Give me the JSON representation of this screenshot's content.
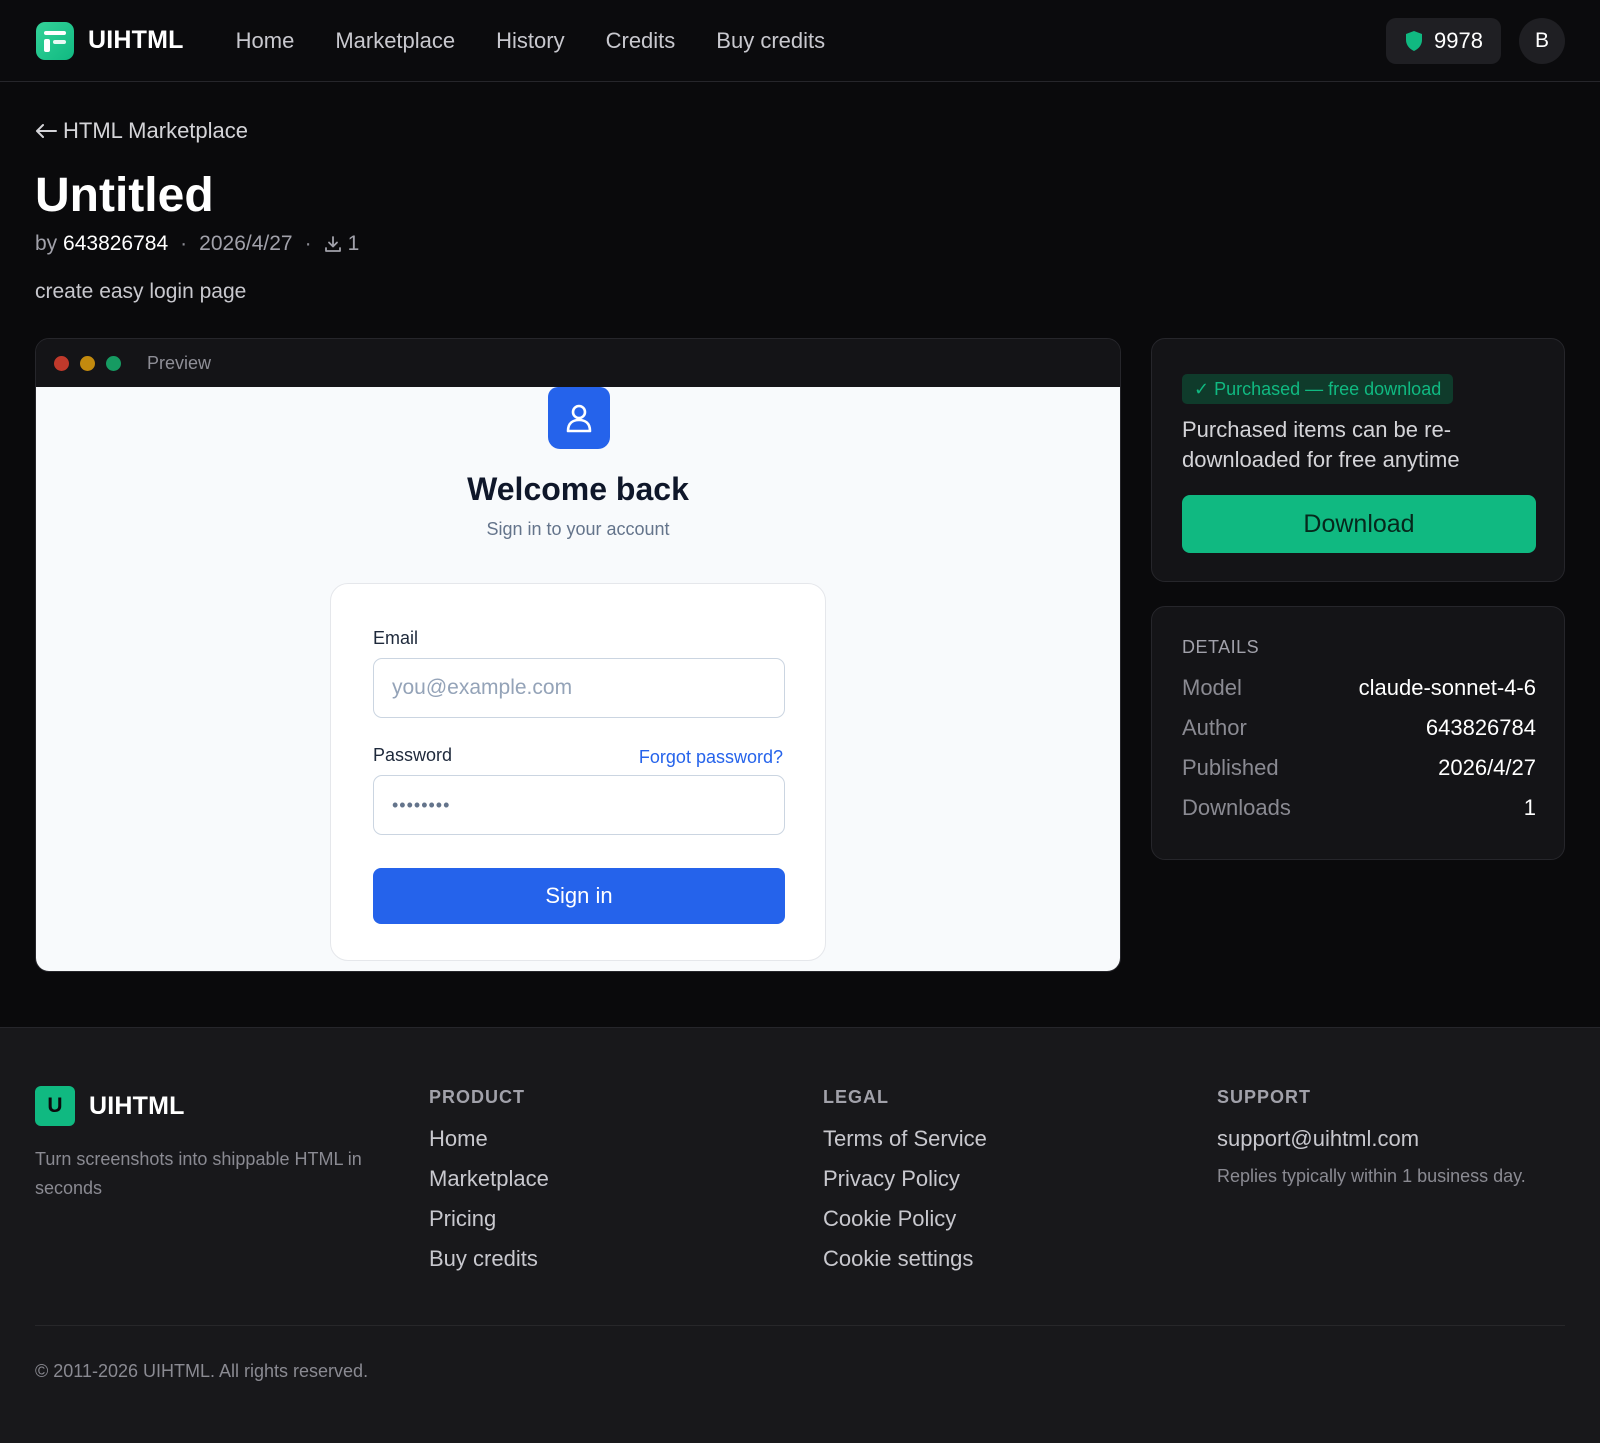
{
  "nav": {
    "brand": "UIHTML",
    "links": [
      "Home",
      "Marketplace",
      "History",
      "Credits",
      "Buy credits"
    ],
    "credits": "9978",
    "avatar": "B"
  },
  "page": {
    "back_label": "HTML Marketplace",
    "title": "Untitled",
    "by": "by",
    "author": "643826784",
    "date": "2026/4/27",
    "downloads": "1",
    "description": "create easy login page"
  },
  "preview": {
    "label": "Preview",
    "welcome": "Welcome back",
    "subtitle": "Sign in to your account",
    "email_label": "Email",
    "email_placeholder": "you@example.com",
    "password_label": "Password",
    "forgot": "Forgot password?",
    "password_value": "••••••••",
    "signin": "Sign in",
    "colors": {
      "primary": "#2563eb",
      "light_red": "#c0392b",
      "light_yellow": "#c28a0e",
      "light_green": "#169b62"
    }
  },
  "purchase": {
    "badge": "✓ Purchased — free download",
    "text": "Purchased items can be re-downloaded for free anytime",
    "download": "Download",
    "accent": "#10b981"
  },
  "details": {
    "heading": "DETAILS",
    "rows": [
      {
        "k": "Model",
        "v": "claude-sonnet-4-6"
      },
      {
        "k": "Author",
        "v": "643826784"
      },
      {
        "k": "Published",
        "v": "2026/4/27"
      },
      {
        "k": "Downloads",
        "v": "1"
      }
    ]
  },
  "footer": {
    "logo_letter": "U",
    "brand": "UIHTML",
    "tagline": "Turn screenshots into shippable HTML in seconds",
    "product": {
      "heading": "PRODUCT",
      "links": [
        "Home",
        "Marketplace",
        "Pricing",
        "Buy credits"
      ]
    },
    "legal": {
      "heading": "LEGAL",
      "links": [
        "Terms of Service",
        "Privacy Policy",
        "Cookie Policy",
        "Cookie settings"
      ]
    },
    "support": {
      "heading": "SUPPORT",
      "email": "support@uihtml.com",
      "note": "Replies typically within 1 business day."
    },
    "copyright": "© 2011-2026 UIHTML. All rights reserved."
  }
}
